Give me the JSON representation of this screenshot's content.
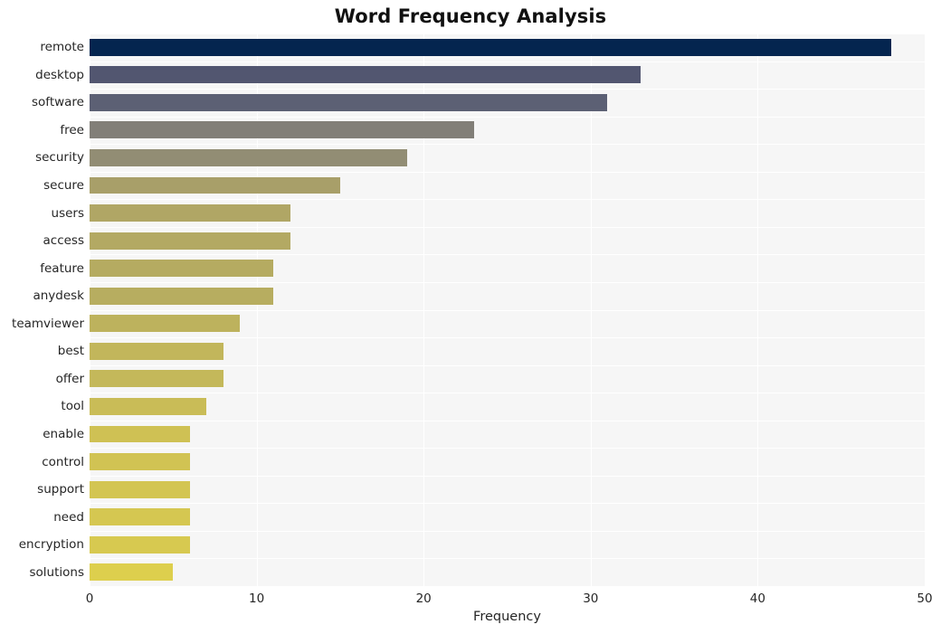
{
  "chart_data": {
    "type": "bar",
    "orientation": "horizontal",
    "title": "Word Frequency Analysis",
    "xlabel": "Frequency",
    "ylabel": "",
    "xlim": [
      0,
      50
    ],
    "ylim": [
      0,
      20
    ],
    "xticks": [
      0,
      10,
      20,
      30,
      40,
      50
    ],
    "xtick_labels": [
      "0",
      "10",
      "20",
      "30",
      "40",
      "50"
    ],
    "grid": true,
    "grid_color": "#ffffff",
    "plot_background": "#f6f6f6",
    "figure_background": "#ffffff",
    "legend": null,
    "colormap": "cividis",
    "categories": [
      "remote",
      "desktop",
      "software",
      "free",
      "security",
      "secure",
      "users",
      "access",
      "feature",
      "anydesk",
      "teamviewer",
      "best",
      "offer",
      "tool",
      "enable",
      "control",
      "support",
      "need",
      "encryption",
      "solutions"
    ],
    "values": [
      48,
      33,
      31,
      23,
      19,
      15,
      12,
      12,
      11,
      11,
      9,
      8,
      8,
      7,
      6,
      6,
      6,
      6,
      6,
      5
    ],
    "bar_colors": [
      "#04254f",
      "#525670",
      "#5c6074",
      "#827f78",
      "#928d74",
      "#a89f69",
      "#b0a665",
      "#b3a963",
      "#b5ab61",
      "#b7ad60",
      "#bdb25d",
      "#c2b65b",
      "#c4b85a",
      "#c9bc57",
      "#cfc154",
      "#d1c353",
      "#d3c552",
      "#d5c751",
      "#d7c950",
      "#ddcf4d"
    ]
  }
}
